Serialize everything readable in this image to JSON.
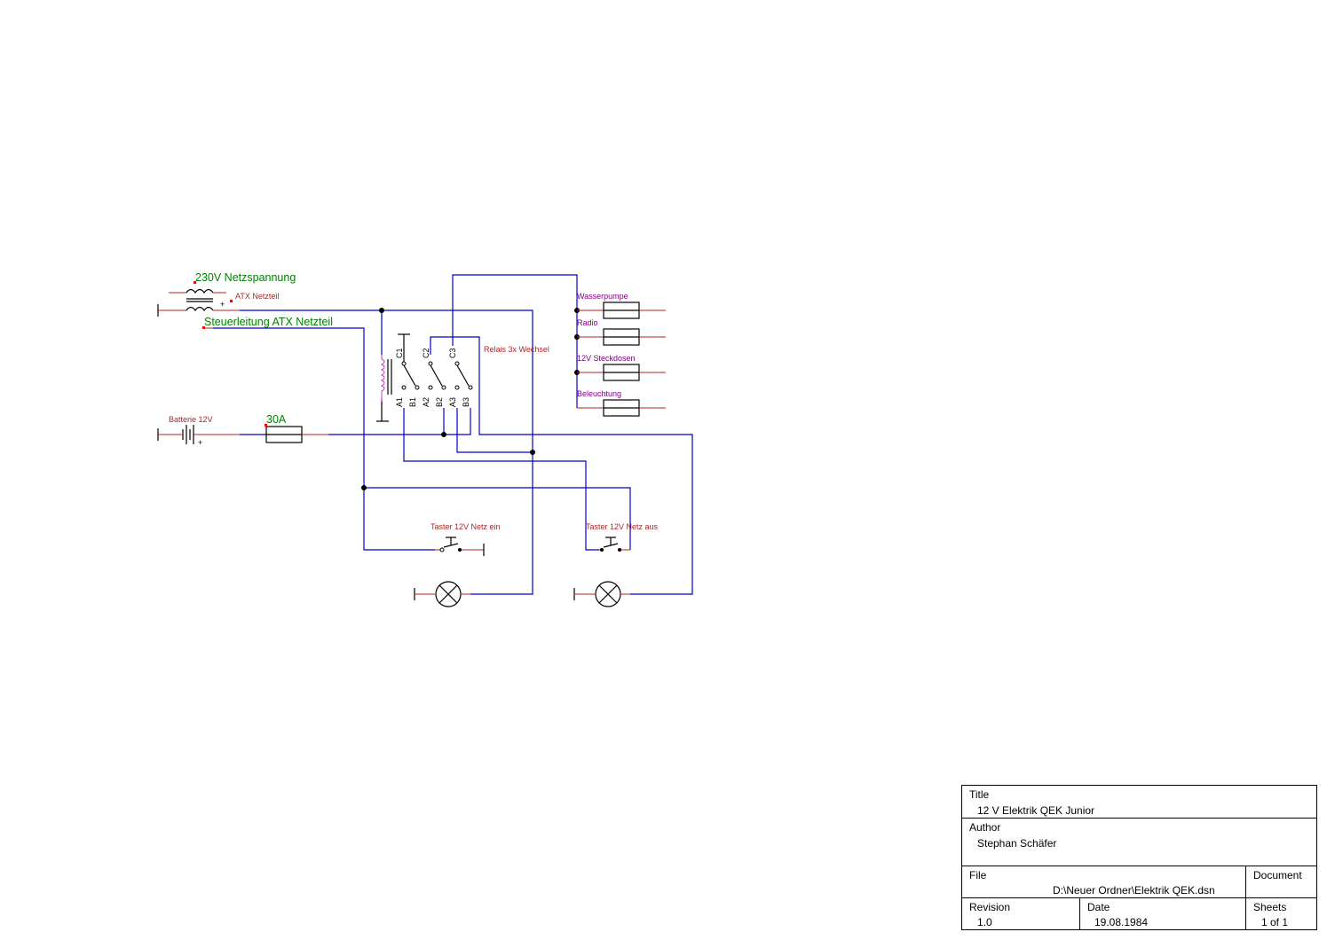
{
  "schematic": {
    "labels": {
      "mains": "230V Netzspannung",
      "atx": "ATX Netzteil",
      "control": "Steuerleitung ATX Netzteil",
      "battery": "Batterie 12V",
      "fuse": "30A",
      "relay": "Relais 3x Wechsel",
      "load1": "Wasserpumpe",
      "load2": "Radio",
      "load3": "12V Steckdosen",
      "load4": "Beleuchtung",
      "button_on": "Taster 12V Netz ein",
      "button_off": "Taster 12V Netz aus",
      "plus": "+"
    },
    "relay_pins": {
      "c1": "C1",
      "c2": "C2",
      "c3": "C3",
      "a1": "A1",
      "b1": "B1",
      "a2": "A2",
      "b2": "B2",
      "a3": "A3",
      "b3": "B3"
    },
    "colors": {
      "wire": "#0000cc",
      "lead": "#b22222",
      "label": "#a52a2a",
      "net_label": "#008000",
      "load_label": "#800080"
    }
  },
  "title_block": {
    "title_label": "Title",
    "title": "12 V Elektrik QEK Junior",
    "author_label": "Author",
    "author": "Stephan Schäfer",
    "file_label": "File",
    "file": "D:\\Neuer Ordner\\Elektrik QEK.dsn",
    "document_label": "Document",
    "revision_label": "Revision",
    "revision": "1.0",
    "date_label": "Date",
    "date": "19.08.1984",
    "sheets_label": "Sheets",
    "sheets": "1 of 1"
  }
}
